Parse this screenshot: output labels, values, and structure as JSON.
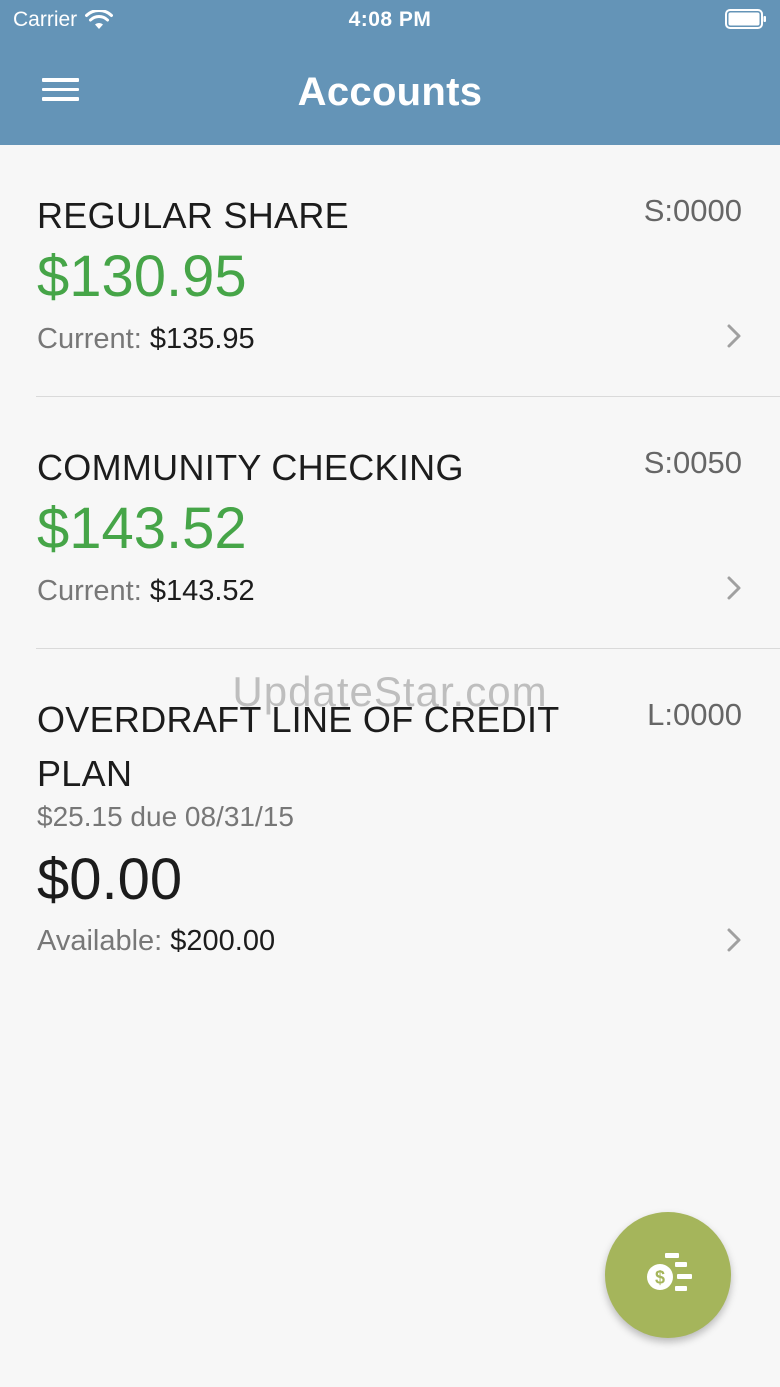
{
  "status_bar": {
    "carrier": "Carrier",
    "time": "4:08 PM"
  },
  "header": {
    "title": "Accounts"
  },
  "accounts": [
    {
      "name": "REGULAR SHARE",
      "code": "S:0000",
      "balance": "$130.95",
      "sub_label": "Current:",
      "sub_value": "$135.95"
    },
    {
      "name": "COMMUNITY CHECKING",
      "code": "S:0050",
      "balance": "$143.52",
      "sub_label": "Current:",
      "sub_value": "$143.52"
    },
    {
      "name": "OVERDRAFT LINE OF CREDIT PLAN",
      "code": "L:0000",
      "due": "$25.15 due 08/31/15",
      "balance": "$0.00",
      "sub_label": "Available:",
      "sub_value": "$200.00"
    }
  ],
  "watermark": "UpdateStar.com",
  "colors": {
    "header": "#6494b7",
    "balance_green": "#46a548",
    "fab": "#a5b55b"
  },
  "icons": [
    "wifi-icon",
    "battery-icon",
    "menu-icon",
    "chevron-right-icon",
    "transfer-money-icon"
  ]
}
